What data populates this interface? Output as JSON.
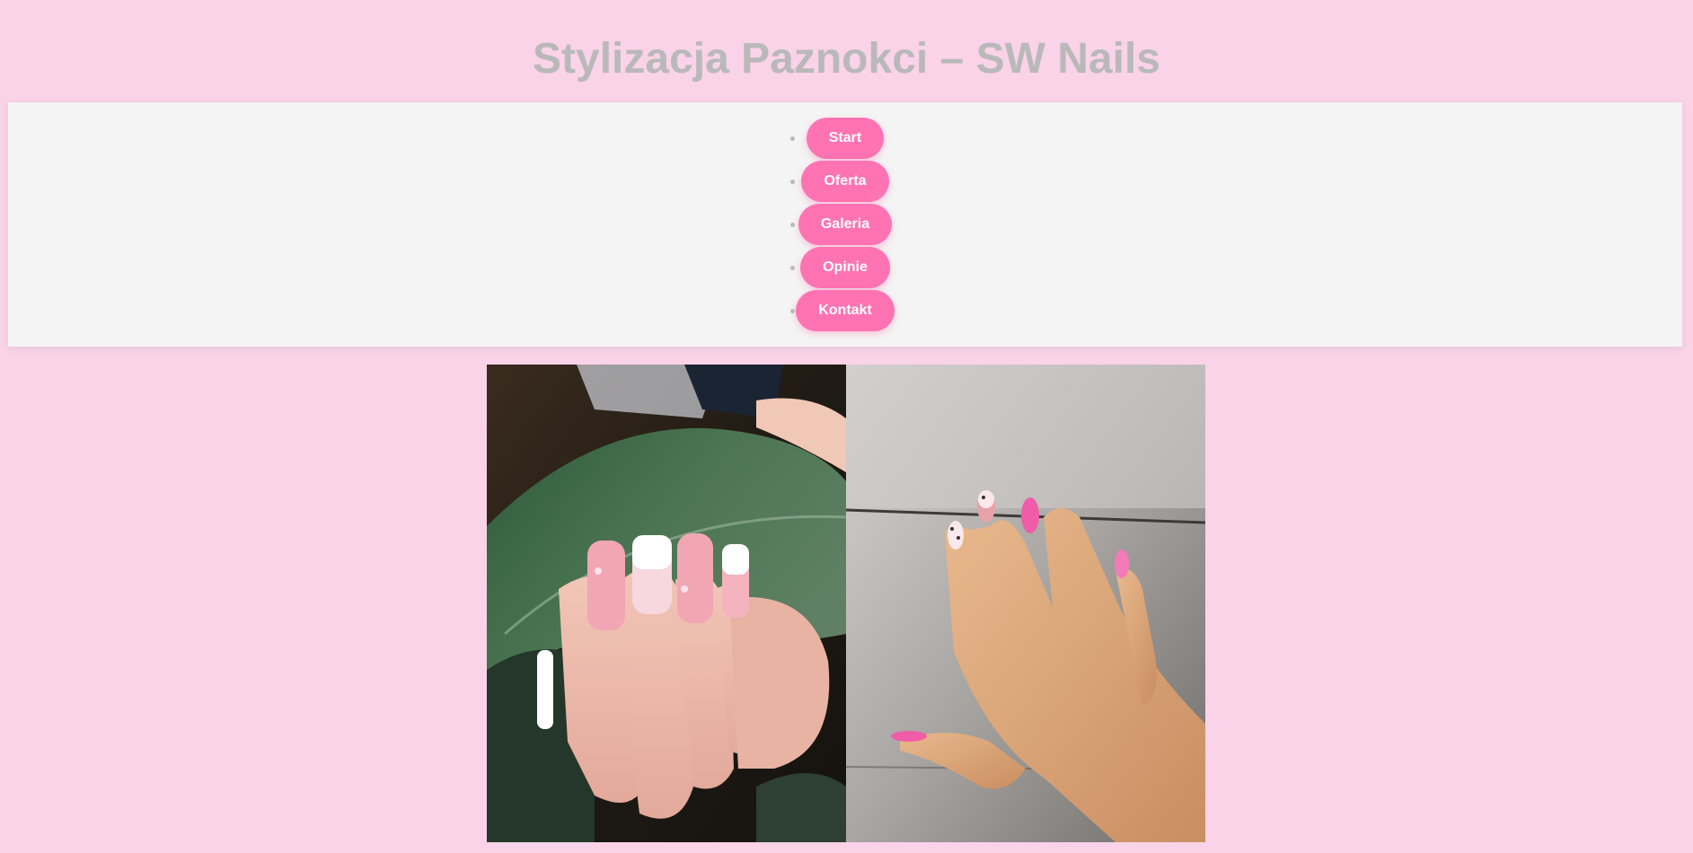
{
  "header": {
    "title": "Stylizacja Paznokci – SW Nails"
  },
  "nav": {
    "items": [
      {
        "label": "Start"
      },
      {
        "label": "Oferta"
      },
      {
        "label": "Galeria"
      },
      {
        "label": "Opinie"
      },
      {
        "label": "Kontakt"
      }
    ]
  },
  "colors": {
    "background": "#fad3e8",
    "nav_bg": "#f4f4f4",
    "button": "#ff73b3",
    "title": "#b9b9b9"
  }
}
